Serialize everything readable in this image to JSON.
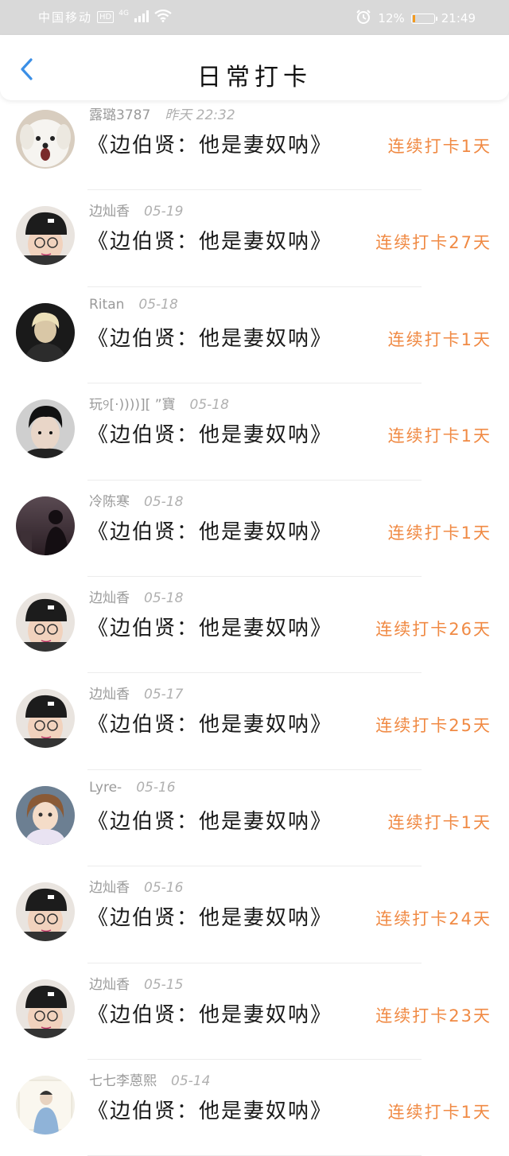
{
  "status_bar": {
    "carrier": "中国移动",
    "hd": "HD",
    "network": "4G",
    "battery_percent": "12%",
    "battery_level": 0.12,
    "time": "21:49",
    "icons": [
      "signal-icon",
      "wifi-icon",
      "alarm-icon",
      "battery-icon"
    ]
  },
  "header": {
    "title": "日常打卡",
    "back_icon": "chevron-left-icon",
    "accent_color": "#3b8fe6"
  },
  "colors": {
    "streak": "#f08a44",
    "name": "#9a9a9a"
  },
  "items": [
    {
      "name": "露璐3787",
      "time": "昨天 22:32",
      "book": "《边伯贤：他是妻奴呐》",
      "streak": "连续打卡1天",
      "avatar": "white-dog-avatar"
    },
    {
      "name": "边灿香",
      "time": "05-19",
      "book": "《边伯贤：他是妻奴呐》",
      "streak": "连续打卡27天",
      "avatar": "man-black-cap-avatar"
    },
    {
      "name": "Ritan",
      "time": "05-18",
      "book": "《边伯贤：他是妻奴呐》",
      "streak": "连续打卡1天",
      "avatar": "blond-person-avatar"
    },
    {
      "name": "玩୨[·))))][ ”寶",
      "time": "05-18",
      "book": "《边伯贤：他是妻奴呐》",
      "streak": "连续打卡1天",
      "avatar": "man-dark-hair-avatar"
    },
    {
      "name": "冷陈寒",
      "time": "05-18",
      "book": "《边伯贤：他是妻奴呐》",
      "streak": "连续打卡1天",
      "avatar": "silhouette-dusk-avatar"
    },
    {
      "name": "边灿香",
      "time": "05-18",
      "book": "《边伯贤：他是妻奴呐》",
      "streak": "连续打卡26天",
      "avatar": "man-black-cap-avatar"
    },
    {
      "name": "边灿香",
      "time": "05-17",
      "book": "《边伯贤：他是妻奴呐》",
      "streak": "连续打卡25天",
      "avatar": "man-black-cap-avatar"
    },
    {
      "name": "Lyre-",
      "time": "05-16",
      "book": "《边伯贤：他是妻奴呐》",
      "streak": "连续打卡1天",
      "avatar": "doll-avatar"
    },
    {
      "name": "边灿香",
      "time": "05-16",
      "book": "《边伯贤：他是妻奴呐》",
      "streak": "连续打卡24天",
      "avatar": "man-black-cap-avatar"
    },
    {
      "name": "边灿香",
      "time": "05-15",
      "book": "《边伯贤：他是妻奴呐》",
      "streak": "连续打卡23天",
      "avatar": "man-black-cap-avatar"
    },
    {
      "name": "七七李蒽熙",
      "time": "05-14",
      "book": "《边伯贤：他是妻奴呐》",
      "streak": "连续打卡1天",
      "avatar": "person-light-bg-avatar"
    }
  ]
}
